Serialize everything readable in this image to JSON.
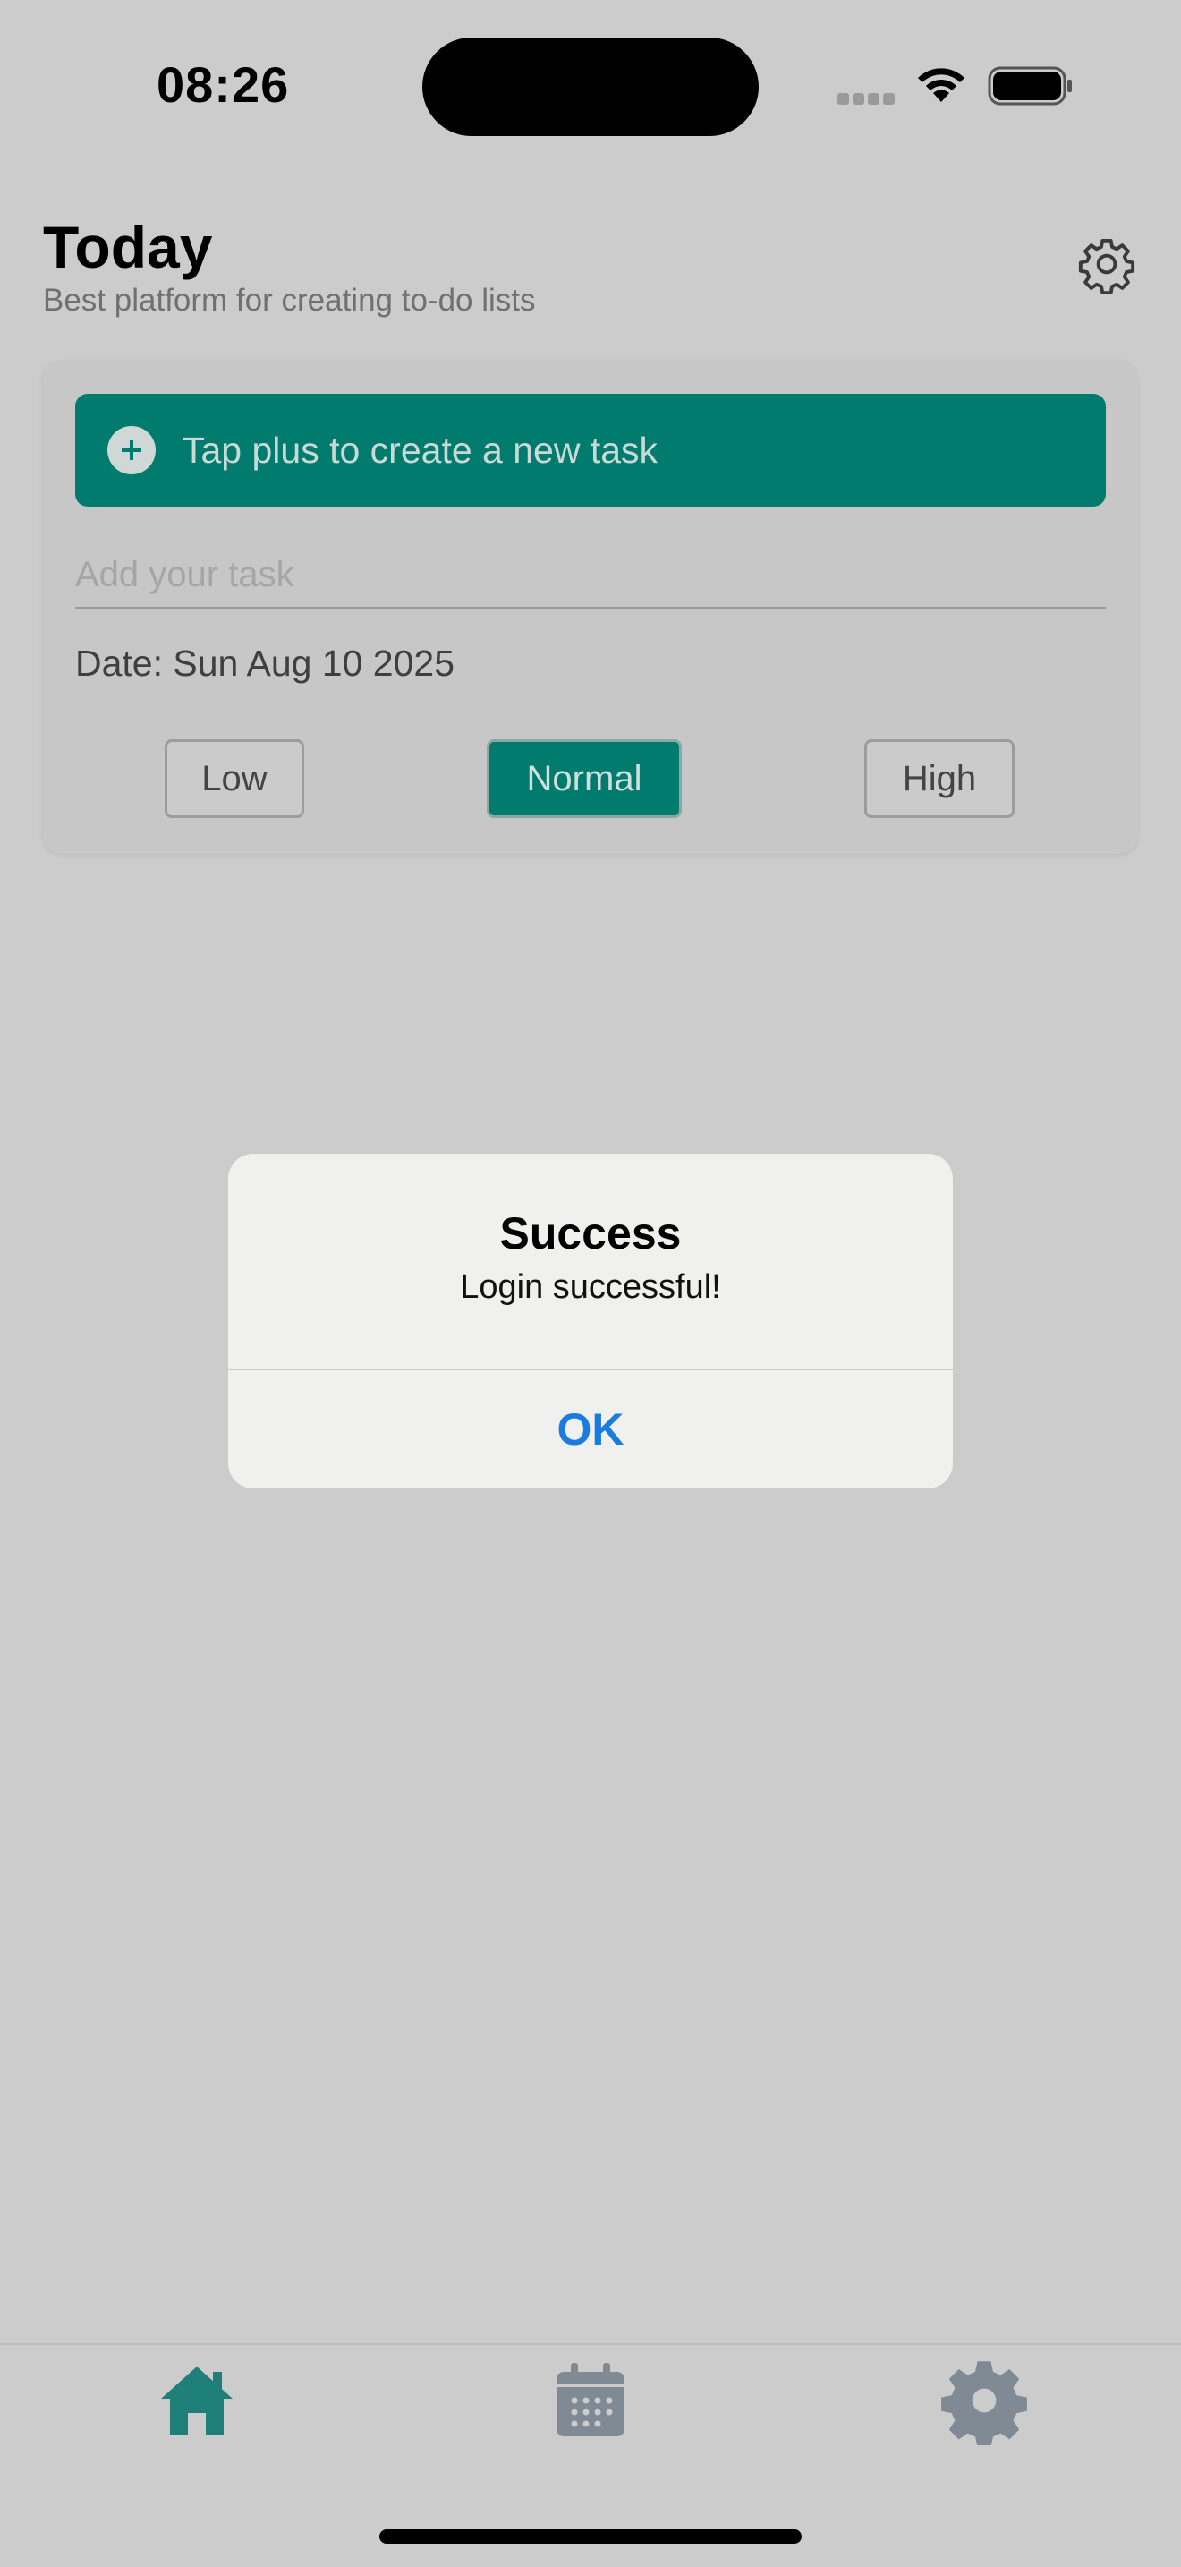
{
  "status_bar": {
    "time": "08:26"
  },
  "header": {
    "title": "Today",
    "subtitle": "Best platform for creating to-do lists"
  },
  "task_card": {
    "banner_text": "Tap plus to create a new task",
    "input_placeholder": "Add your task",
    "input_value": "",
    "date_text": "Date: Sun Aug 10 2025",
    "priority": {
      "options": [
        "Low",
        "Normal",
        "High"
      ],
      "selected": "Normal"
    }
  },
  "alert": {
    "title": "Success",
    "message": "Login successful!",
    "ok_label": "OK"
  },
  "tab_bar": {
    "tabs": [
      {
        "icon": "home-icon",
        "active": true
      },
      {
        "icon": "calendar-icon",
        "active": false
      },
      {
        "icon": "gear-icon",
        "active": false
      }
    ]
  },
  "colors": {
    "accent": "#007b6e",
    "background": "#cccccc",
    "alert_button": "#1a7be0",
    "tab_inactive": "#808a94"
  }
}
